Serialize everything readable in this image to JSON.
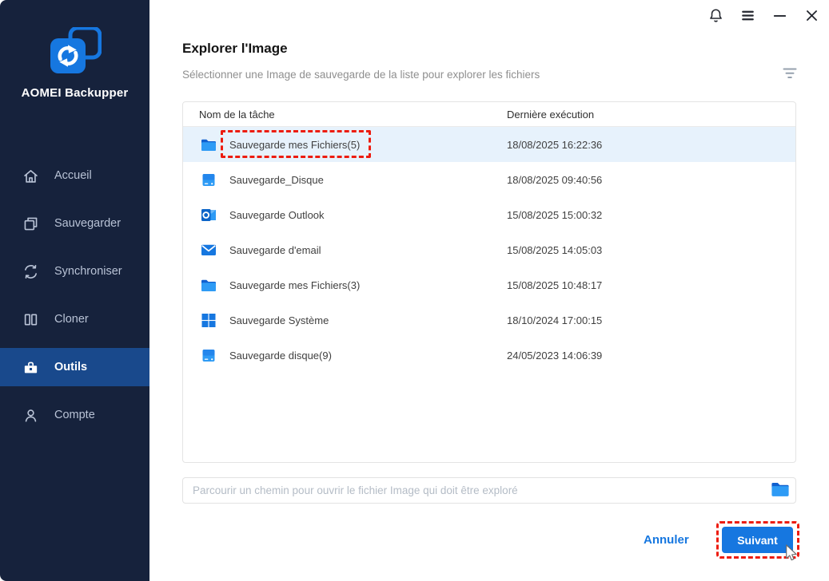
{
  "app_name": "AOMEI Backupper",
  "window_controls": [
    {
      "name": "notifications-button",
      "icon": "bell-icon"
    },
    {
      "name": "menu-button",
      "icon": "menu-icon"
    },
    {
      "name": "minimize-button",
      "icon": "minimize-icon"
    },
    {
      "name": "close-button",
      "icon": "close-icon"
    }
  ],
  "sidebar": {
    "items": [
      {
        "id": "accueil",
        "label": "Accueil",
        "icon": "home-icon",
        "active": false
      },
      {
        "id": "sauvegarder",
        "label": "Sauvegarder",
        "icon": "copy-icon",
        "active": false
      },
      {
        "id": "synchroniser",
        "label": "Synchroniser",
        "icon": "sync-icon",
        "active": false
      },
      {
        "id": "cloner",
        "label": "Cloner",
        "icon": "clone-icon",
        "active": false
      },
      {
        "id": "outils",
        "label": "Outils",
        "icon": "toolbox-icon",
        "active": true
      },
      {
        "id": "compte",
        "label": "Compte",
        "icon": "user-icon",
        "active": false
      }
    ]
  },
  "header": {
    "title": "Explorer l'Image",
    "subtitle": "Sélectionner une Image de sauvegarde de la liste pour explorer les fichiers"
  },
  "table": {
    "columns": [
      "Nom de la tâche",
      "Dernière exécution"
    ],
    "rows": [
      {
        "icon": "folder-icon",
        "name": "Sauvegarde mes Fichiers(5)",
        "last_run": "18/08/2025 16:22:36",
        "selected": true,
        "annotated": true
      },
      {
        "icon": "disk-icon",
        "name": "Sauvegarde_Disque",
        "last_run": "18/08/2025 09:40:56",
        "selected": false,
        "annotated": false
      },
      {
        "icon": "outlook-icon",
        "name": "Sauvegarde Outlook",
        "last_run": "15/08/2025 15:00:32",
        "selected": false,
        "annotated": false
      },
      {
        "icon": "mail-icon",
        "name": "Sauvegarde d'email",
        "last_run": "15/08/2025 14:05:03",
        "selected": false,
        "annotated": false
      },
      {
        "icon": "folder-icon",
        "name": "Sauvegarde mes Fichiers(3)",
        "last_run": "15/08/2025 10:48:17",
        "selected": false,
        "annotated": false
      },
      {
        "icon": "windows-icon",
        "name": "Sauvegarde Système",
        "last_run": "18/10/2024 17:00:15",
        "selected": false,
        "annotated": false
      },
      {
        "icon": "disk-icon",
        "name": "Sauvegarde disque(9)",
        "last_run": "24/05/2023 14:06:39",
        "selected": false,
        "annotated": false
      }
    ]
  },
  "path_input": {
    "placeholder": "Parcourir un chemin pour ouvrir le fichier Image qui doit être exploré",
    "value": "",
    "icon": "folder-icon"
  },
  "footer": {
    "cancel_label": "Annuler",
    "next_label": "Suivant"
  },
  "colors": {
    "accent": "#1677e0",
    "sidebar_bg": "#16223c",
    "nav_active_bg": "#19498c",
    "selected_row_bg": "#e7f2fc",
    "annotation_red": "#ed1c0f"
  }
}
